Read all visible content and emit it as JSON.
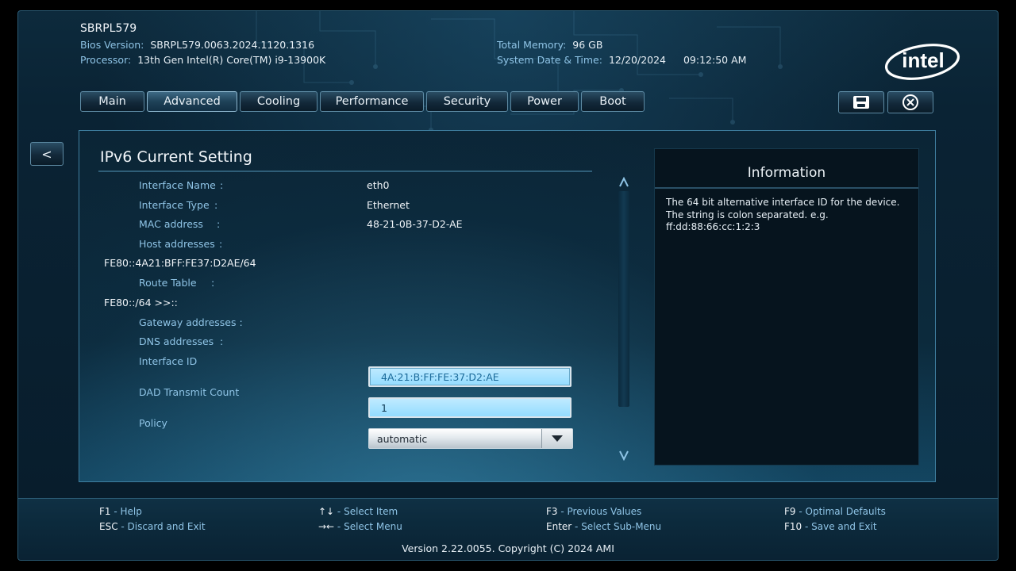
{
  "header": {
    "system_name": "SBRPL579",
    "bios_version_label": "Bios Version:",
    "bios_version": "SBRPL579.0063.2024.1120.1316",
    "processor_label": "Processor:",
    "processor": "13th Gen Intel(R) Core(TM) i9-13900K",
    "memory_label": "Total Memory:",
    "memory": "96 GB",
    "datetime_label": "System Date & Time:",
    "date": "12/20/2024",
    "time": "09:12:50 AM",
    "logo_text": "intel"
  },
  "tabs": [
    {
      "label": "Main"
    },
    {
      "label": "Advanced",
      "active": true
    },
    {
      "label": "Cooling"
    },
    {
      "label": "Performance"
    },
    {
      "label": "Security"
    },
    {
      "label": "Power"
    },
    {
      "label": "Boot"
    }
  ],
  "toolbar": {
    "save_icon": "save-icon",
    "exit_icon": "close-circle-icon"
  },
  "back_label": "<",
  "page": {
    "title": "IPv6 Current Setting",
    "rows": {
      "interface_name": {
        "label": "Interface Name",
        "value": "eth0"
      },
      "interface_type": {
        "label": "Interface Type",
        "value": "Ethernet"
      },
      "mac_address": {
        "label": "MAC address",
        "value": "48-21-0B-37-D2-AE"
      },
      "host_addresses": {
        "label": "Host addresses",
        "value": "FE80::4A21:BFF:FE37:D2AE/64"
      },
      "route_table": {
        "label": "Route Table",
        "value": "FE80::/64 >>::"
      },
      "gateway_addresses": {
        "label": "Gateway addresses :"
      },
      "dns_addresses": {
        "label": "DNS addresses"
      },
      "interface_id": {
        "label": "Interface ID",
        "value": "4A:21:B:FF:FE:37:D2:AE"
      },
      "dad_transmit_count": {
        "label": "DAD Transmit Count",
        "value": "1"
      },
      "policy": {
        "label": "Policy",
        "value": "automatic"
      }
    },
    "colon": ":"
  },
  "information": {
    "title": "Information",
    "text": "The 64 bit alternative interface ID for the device. The string is colon separated. e.g. ff:dd:88:66:cc:1:2:3"
  },
  "footer": {
    "keys": [
      {
        "key": "F1",
        "desc": "Help"
      },
      {
        "key": "ESC",
        "desc": "Discard and Exit"
      },
      {
        "key": "↑↓",
        "desc": "Select Item"
      },
      {
        "key": "→←",
        "desc": "Select Menu"
      },
      {
        "key": "F3",
        "desc": "Previous Values"
      },
      {
        "key": "Enter",
        "desc": "Select Sub-Menu"
      },
      {
        "key": "F9",
        "desc": "Optimal Defaults"
      },
      {
        "key": "F10",
        "desc": "Save and Exit"
      }
    ],
    "separator": " - ",
    "version": "Version 2.22.0055. Copyright (C) 2024 AMI"
  },
  "colors": {
    "accent": "#8fc4e6",
    "field_bg": "#93dcff",
    "panel_border": "#3f7fa0"
  }
}
